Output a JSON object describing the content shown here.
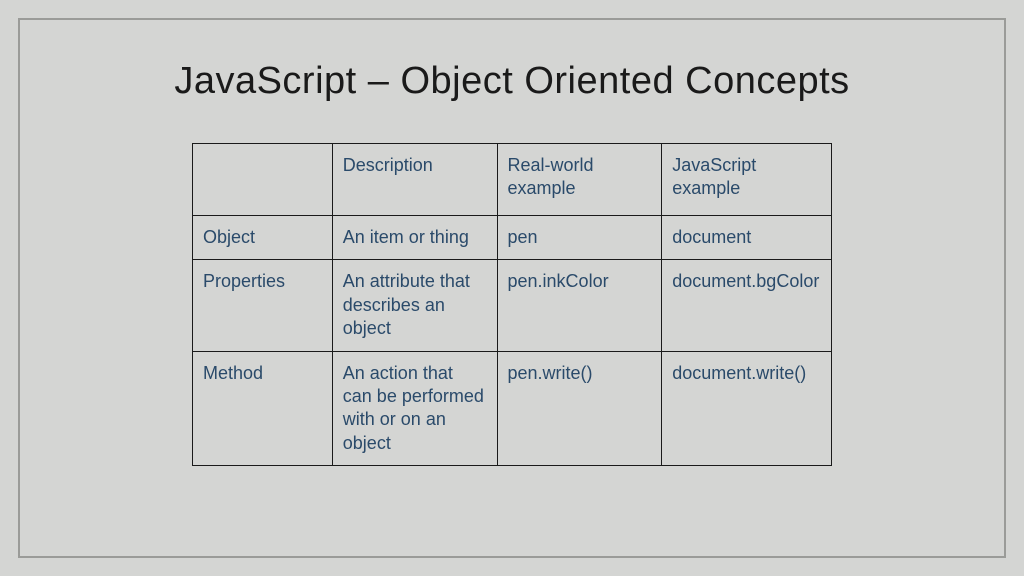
{
  "title": "JavaScript – Object Oriented Concepts",
  "headers": {
    "col0": "",
    "col1": "Description",
    "col2": "Real-world example",
    "col3": "JavaScript example"
  },
  "rows": [
    {
      "label": "Object",
      "description": "An item or thing",
      "realworld": "pen",
      "js": "document"
    },
    {
      "label": "Properties",
      "description": "An attribute that describes an object",
      "realworld": "pen.inkColor",
      "js": "document.bgColor"
    },
    {
      "label": "Method",
      "description": "An action that can be performed with or on an object",
      "realworld": "pen.write()",
      "js": "document.write()"
    }
  ]
}
